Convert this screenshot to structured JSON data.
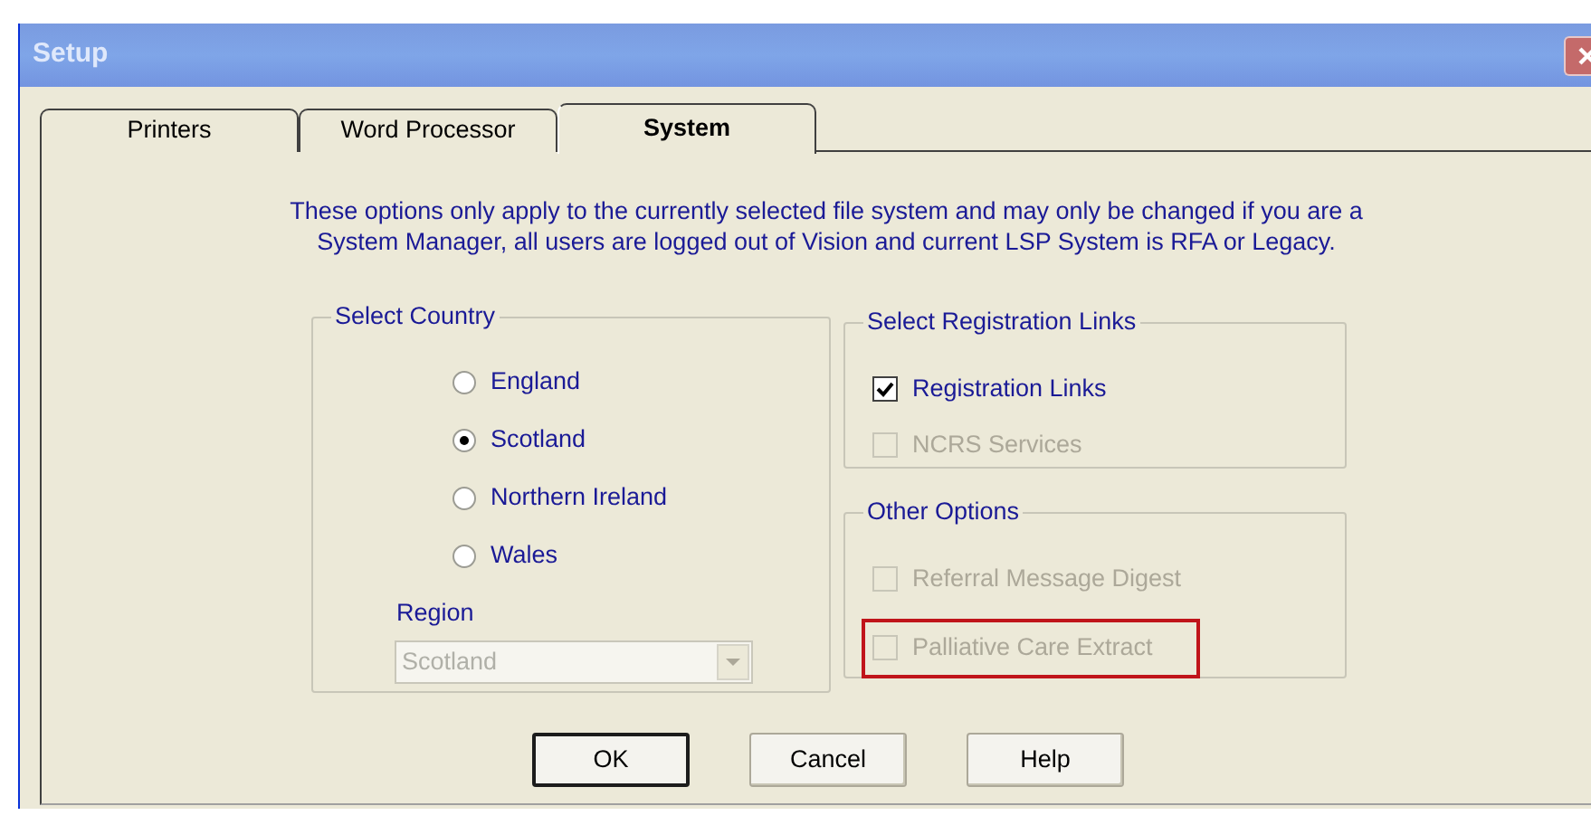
{
  "window": {
    "title": "Setup"
  },
  "tabs": [
    {
      "label": "Printers",
      "selected": false
    },
    {
      "label": "Word Processor",
      "selected": false
    },
    {
      "label": "System",
      "selected": true
    }
  ],
  "notice": "These options only apply to the currently selected file system and may only be changed if you are a\nSystem Manager, all users are logged out of Vision and current LSP System is RFA or Legacy.",
  "country_group": {
    "title": "Select Country",
    "options": [
      {
        "label": "England",
        "selected": false
      },
      {
        "label": "Scotland",
        "selected": true
      },
      {
        "label": "Northern Ireland",
        "selected": false
      },
      {
        "label": "Wales",
        "selected": false
      }
    ],
    "region": {
      "label": "Region",
      "value": "Scotland",
      "disabled": true
    }
  },
  "registration_group": {
    "title": "Select Registration Links",
    "options": [
      {
        "label": "Registration Links",
        "checked": true,
        "disabled": false,
        "highlighted": false
      },
      {
        "label": "NCRS Services",
        "checked": false,
        "disabled": true,
        "highlighted": false
      }
    ]
  },
  "other_group": {
    "title": "Other Options",
    "options": [
      {
        "label": "Referral Message Digest",
        "checked": false,
        "disabled": true,
        "highlighted": false
      },
      {
        "label": "Palliative Care Extract",
        "checked": false,
        "disabled": true,
        "highlighted": true
      }
    ]
  },
  "buttons": [
    {
      "label": "OK",
      "default": true
    },
    {
      "label": "Cancel",
      "default": false
    },
    {
      "label": "Help",
      "default": false
    }
  ]
}
